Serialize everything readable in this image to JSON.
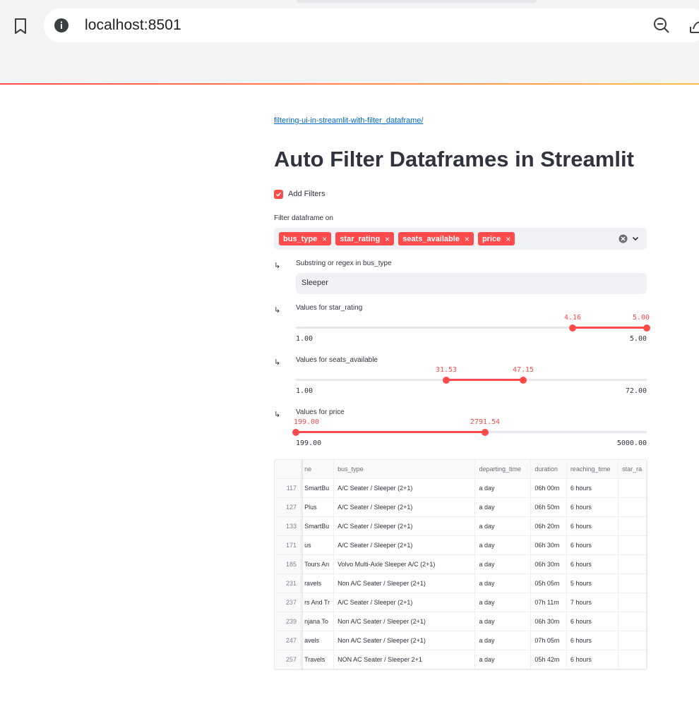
{
  "browser": {
    "url": "localhost:8501"
  },
  "page": {
    "link": "filtering-ui-in-streamlit-with-filter_dataframe/",
    "title": "Auto Filter Dataframes in Streamlit",
    "add_filters_label": "Add Filters",
    "add_filters_checked": true,
    "filter_on_label": "Filter dataframe on",
    "chips": [
      "bus_type",
      "star_rating",
      "seats_available",
      "price"
    ],
    "chip_remove_glyph": "×",
    "arrow_glyph": "↳"
  },
  "filters": {
    "bus_type": {
      "label": "Substring or regex in bus_type",
      "value": "Sleeper"
    },
    "star_rating": {
      "label": "Values for star_rating",
      "min": "1.00",
      "max": "5.00",
      "low": "4.16",
      "high": "5.00"
    },
    "seats_available": {
      "label": "Values for seats_available",
      "min": "1.00",
      "max": "72.00",
      "low": "31.53",
      "high": "47.15"
    },
    "price": {
      "label": "Values for price",
      "min": "199.00",
      "max": "5000.00",
      "low": "199.00",
      "high": "2791.54"
    }
  },
  "table": {
    "columns": [
      "",
      "ne",
      "bus_type",
      "departing_time",
      "duration",
      "reaching_time",
      "star_ra"
    ],
    "rows": [
      [
        "117",
        "SmartBu",
        "A/C Seater / Sleeper (2+1)",
        "a day",
        "06h 00m",
        "6 hours",
        ""
      ],
      [
        "127",
        "Plus",
        "A/C Seater / Sleeper (2+1)",
        "a day",
        "06h 50m",
        "6 hours",
        ""
      ],
      [
        "133",
        "SmartBu",
        "A/C Seater / Sleeper (2+1)",
        "a day",
        "06h 20m",
        "6 hours",
        ""
      ],
      [
        "171",
        "us",
        "A/C Seater / Sleeper (2+1)",
        "a day",
        "06h 30m",
        "6 hours",
        ""
      ],
      [
        "185",
        "Tours An",
        "Volvo Multi-Axle Sleeper A/C (2+1)",
        "a day",
        "06h 30m",
        "6 hours",
        ""
      ],
      [
        "231",
        "ravels",
        "Non A/C Seater / Sleeper (2+1)",
        "a day",
        "05h 05m",
        "5 hours",
        ""
      ],
      [
        "237",
        "rs And Tr",
        "A/C Seater / Sleeper (2+1)",
        "a day",
        "07h 11m",
        "7 hours",
        ""
      ],
      [
        "239",
        "njana To",
        "Non A/C Seater / Sleeper (2+1)",
        "a day",
        "06h 30m",
        "6 hours",
        ""
      ],
      [
        "247",
        "avels",
        "Non A/C Seater / Sleeper (2+1)",
        "a day",
        "07h 05m",
        "6 hours",
        ""
      ],
      [
        "257",
        "Travels",
        "NON AC Seater / Sleeper 2+1",
        "a day",
        "05h 42m",
        "6 hours",
        ""
      ]
    ]
  }
}
